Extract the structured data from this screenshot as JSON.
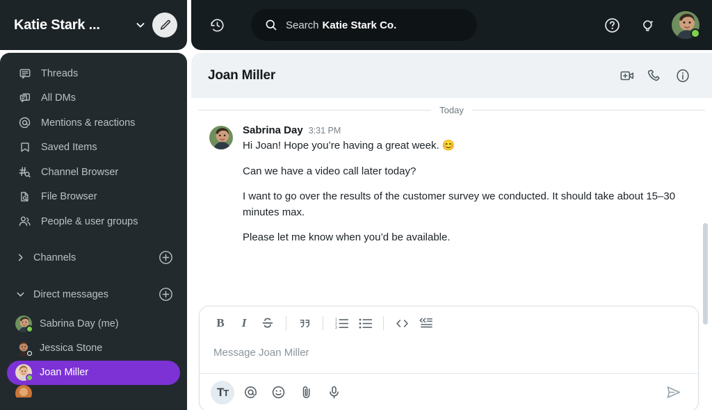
{
  "workspace": {
    "name": "Katie Stark ...",
    "chevron_icon": "chevron-down-icon",
    "compose_icon": "pencil-edit-icon"
  },
  "sidebar": {
    "nav_items": [
      {
        "label": "Threads",
        "icon": "threads-icon"
      },
      {
        "label": "All DMs",
        "icon": "all-dms-icon"
      },
      {
        "label": "Mentions & reactions",
        "icon": "at-mention-icon"
      },
      {
        "label": "Saved Items",
        "icon": "bookmark-icon"
      },
      {
        "label": "Channel Browser",
        "icon": "channel-search-icon"
      },
      {
        "label": "File Browser",
        "icon": "file-search-icon"
      },
      {
        "label": "People & user groups",
        "icon": "people-icon"
      }
    ],
    "sections": [
      {
        "label": "Channels",
        "expanded": false,
        "add_icon": "plus-circle-icon"
      },
      {
        "label": "Direct messages",
        "expanded": true,
        "add_icon": "plus-circle-icon"
      }
    ],
    "direct_messages": [
      {
        "name": "Sabrina Day (me)",
        "presence": "online",
        "active": false
      },
      {
        "name": "Jessica Stone",
        "presence": "dnd",
        "active": false
      },
      {
        "name": "Joan Miller",
        "presence": "online",
        "active": true
      }
    ],
    "active_color": "#7c32d5"
  },
  "topbar": {
    "history_icon": "history-clock-icon",
    "search": {
      "icon": "search-icon",
      "label": "Search",
      "scope": "Katie Stark Co."
    },
    "help_icon": "help-circle-icon",
    "ideas_icon": "lightbulb-sparkle-icon",
    "avatar_icon": "user-avatar",
    "avatar_presence": "online"
  },
  "conversation": {
    "title": "Joan Miller",
    "actions": [
      {
        "label": "Start huddle",
        "icon": "video-add-icon"
      },
      {
        "label": "Call",
        "icon": "phone-icon"
      },
      {
        "label": "Details",
        "icon": "info-circle-icon"
      }
    ],
    "day_divider": "Today",
    "messages": [
      {
        "author": "Sabrina Day",
        "time": "3:31 PM",
        "avatar_icon": "user-avatar",
        "paragraphs": [
          "Hi Joan! Hope you’re having a great week. 😊",
          "Can we have a video call later today?",
          "I want to go over the results of the customer survey we conducted. It should take about 15–30 minutes max.",
          "Please let me know when you’d be available."
        ]
      }
    ]
  },
  "composer": {
    "format_buttons": [
      {
        "name": "bold",
        "glyph": "B",
        "icon": "bold-icon"
      },
      {
        "name": "italic",
        "glyph": "I",
        "icon": "italic-icon"
      },
      {
        "name": "strikethrough",
        "glyph": "S",
        "icon": "strikethrough-icon"
      },
      {
        "name": "blockquote",
        "glyph": "””",
        "icon": "quote-icon"
      },
      {
        "name": "ordered-list",
        "glyph": "",
        "icon": "ordered-list-icon"
      },
      {
        "name": "bulleted-list",
        "glyph": "",
        "icon": "bulleted-list-icon"
      },
      {
        "name": "code",
        "glyph": "<>",
        "icon": "code-icon"
      },
      {
        "name": "code-block",
        "glyph": "",
        "icon": "code-block-icon"
      }
    ],
    "placeholder": "Message Joan Miller",
    "value": "",
    "actions": [
      {
        "name": "formatting",
        "icon": "text-format-icon",
        "active": true
      },
      {
        "name": "mention",
        "icon": "at-icon",
        "active": false
      },
      {
        "name": "emoji",
        "icon": "emoji-smiley-icon",
        "active": false
      },
      {
        "name": "attach",
        "icon": "paperclip-icon",
        "active": false
      },
      {
        "name": "audio",
        "icon": "microphone-icon",
        "active": false
      }
    ],
    "send_icon": "send-paper-plane-icon"
  }
}
